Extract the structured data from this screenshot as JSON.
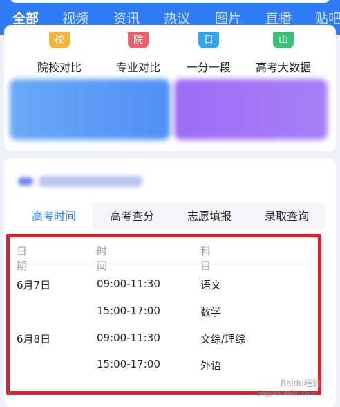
{
  "topnav": {
    "tabs": [
      "全部",
      "视频",
      "资讯",
      "热议",
      "图片",
      "直播",
      "贴吧"
    ],
    "active_index": 0
  },
  "tools": [
    {
      "label": "院校对比",
      "icon": "school-compare-icon",
      "glyph": "校",
      "color": "#f7b23b"
    },
    {
      "label": "专业对比",
      "icon": "major-compare-icon",
      "glyph": "院",
      "color": "#f0606a"
    },
    {
      "label": "一分一段",
      "icon": "score-segment-icon",
      "glyph": "日",
      "color": "#32a6f0"
    },
    {
      "label": "高考大数据",
      "icon": "big-data-icon",
      "glyph": "山",
      "color": "#39c07a"
    }
  ],
  "schedule": {
    "tabs": [
      "高考时间",
      "高考查分",
      "志愿填报",
      "录取查询"
    ],
    "active_tab": 0,
    "columns": [
      "日期",
      "时间",
      "科目"
    ],
    "rows": [
      {
        "date": "6月7日",
        "time": "09:00-11:30",
        "subject": "语文"
      },
      {
        "date": "",
        "time": "15:00-17:00",
        "subject": "数学"
      },
      {
        "date": "6月8日",
        "time": "09:00-11:30",
        "subject": "文综/理综"
      },
      {
        "date": "",
        "time": "15:00-17:00",
        "subject": "外语"
      }
    ]
  },
  "colors": {
    "brand_blue": "#2f7cf6",
    "highlight_red": "#e0202a"
  },
  "watermark": {
    "text": "Baidu经验",
    "sub": "jingyan.baidu.com"
  }
}
